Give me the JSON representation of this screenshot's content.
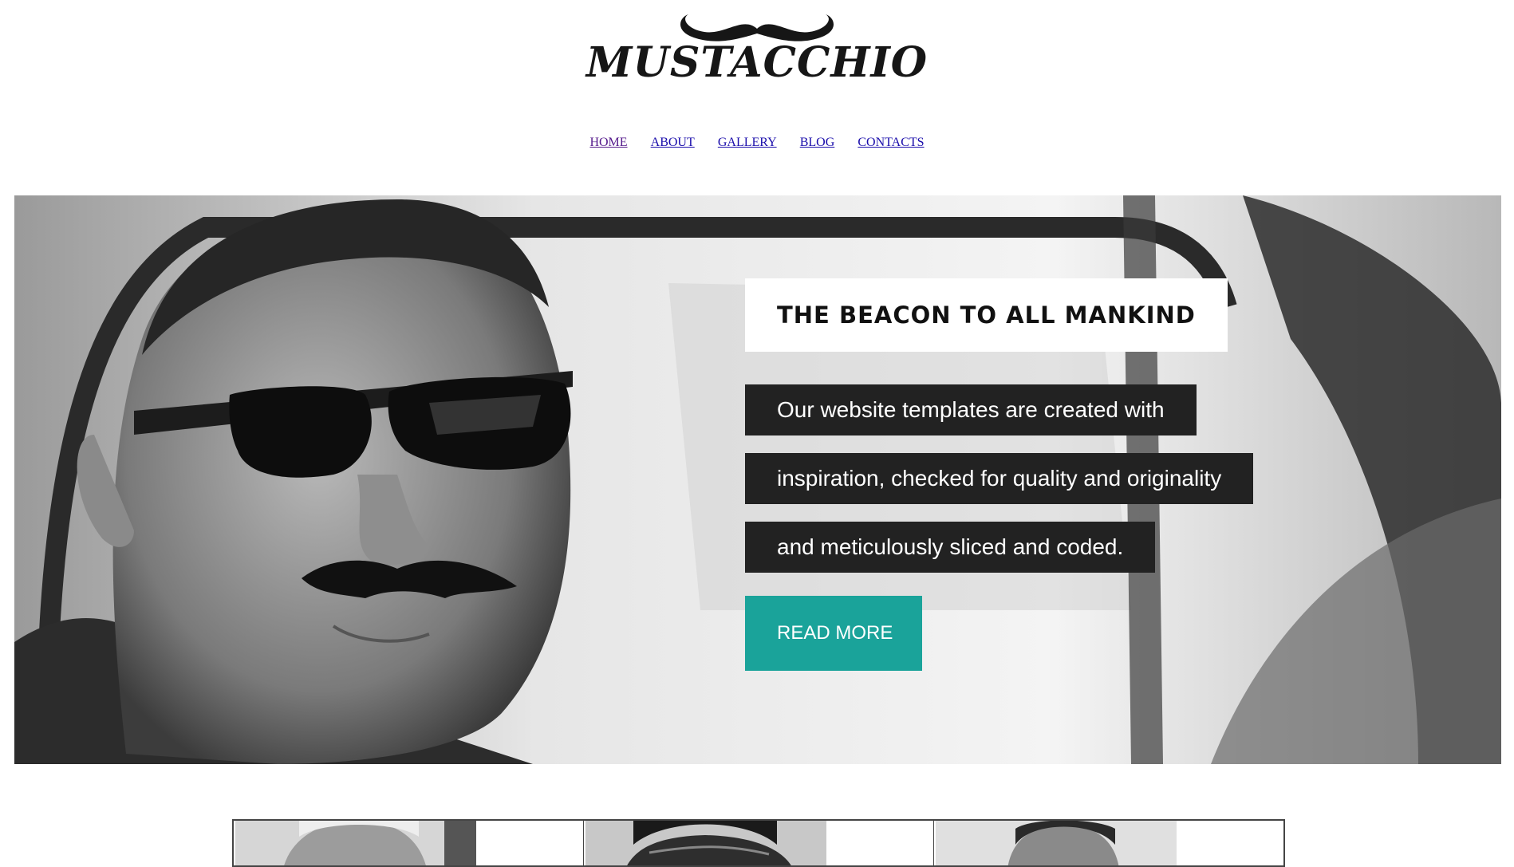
{
  "brand": {
    "logo_text": "MUSTACCHIO",
    "icon": "mustache-icon"
  },
  "nav": {
    "items": [
      {
        "label": "HOME",
        "state": "visited"
      },
      {
        "label": "ABOUT"
      },
      {
        "label": "GALLERY"
      },
      {
        "label": "BLOG"
      },
      {
        "label": "CONTACTS"
      }
    ]
  },
  "hero": {
    "title": "THE BEACON TO ALL MANKIND",
    "lines": [
      "Our website templates are created with",
      "inspiration, checked for quality and originality",
      "and meticulously sliced and coded."
    ],
    "cta": "READ MORE",
    "cta_color": "#1aa39a"
  },
  "gallery": {
    "thumbnails": [
      "portrait-thumbnail",
      "portrait-thumbnail",
      "portrait-thumbnail"
    ]
  }
}
